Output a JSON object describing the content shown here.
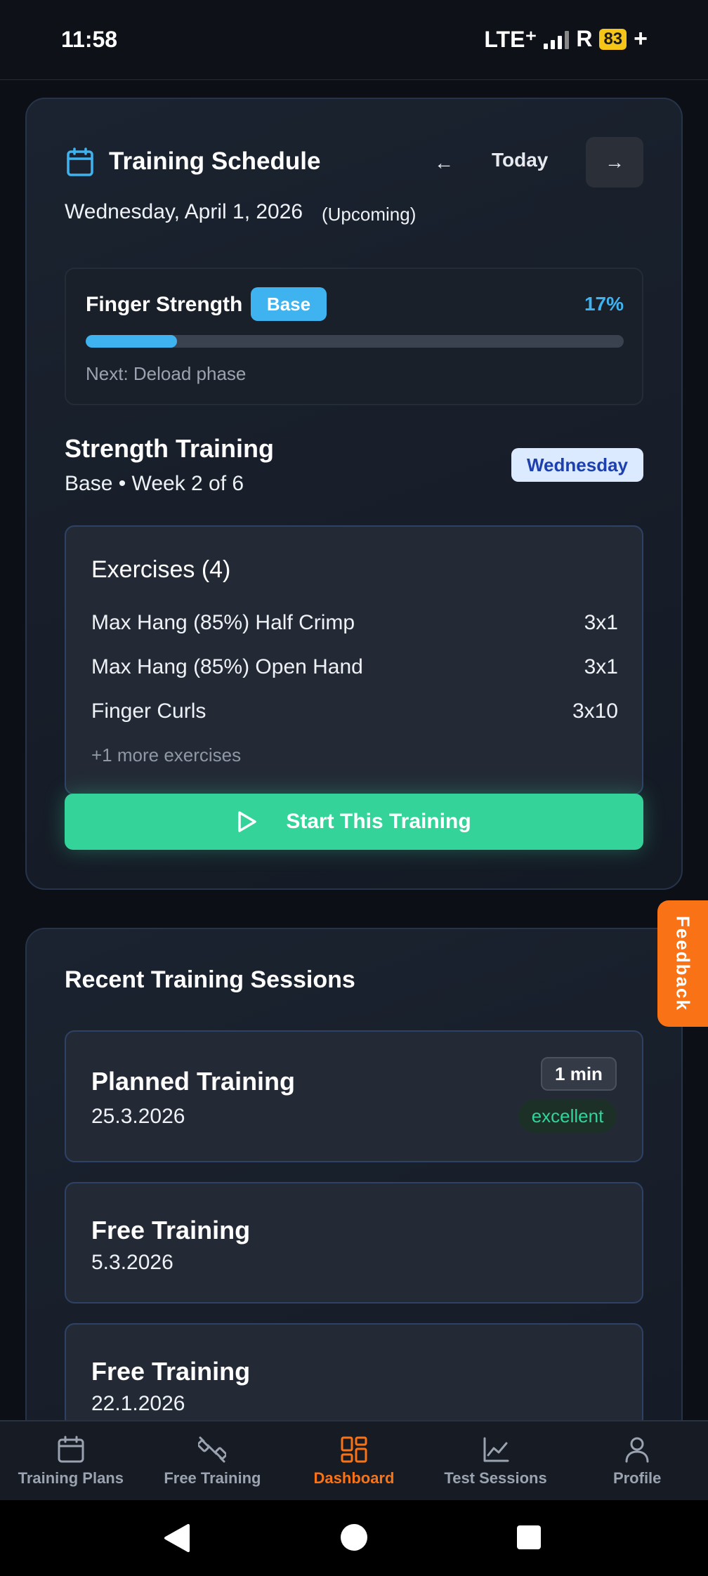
{
  "status_bar": {
    "time": "11:58",
    "network": "LTE⁺",
    "roaming": "R",
    "battery": "83",
    "charging": "+"
  },
  "schedule": {
    "title": "Training Schedule",
    "nav_prev": "←",
    "nav_today": "Today",
    "nav_next": "→",
    "date": "Wednesday, April 1, 2026",
    "status": "(Upcoming)",
    "phase": {
      "name": "Finger Strength",
      "badge": "Base",
      "percent_label": "17%",
      "progress": 0.17,
      "next": "Next: Deload phase"
    },
    "training": {
      "title": "Strength Training",
      "subtitle": "Base • Week 2 of 6",
      "day_badge": "Wednesday"
    },
    "exercises": {
      "title": "Exercises (4)",
      "items": [
        {
          "name": "Max Hang (85%) Half Crimp",
          "sets": "3x1"
        },
        {
          "name": "Max Hang (85%) Open Hand",
          "sets": "3x1"
        },
        {
          "name": "Finger Curls",
          "sets": "3x10"
        }
      ],
      "more": "+1 more exercises"
    },
    "start_button": "Start This Training"
  },
  "feedback": {
    "label": "Feedback"
  },
  "recent": {
    "title": "Recent Training Sessions",
    "sessions": [
      {
        "name": "Planned Training",
        "date": "25.3.2026",
        "duration": "1 min",
        "rating": "excellent"
      },
      {
        "name": "Free Training",
        "date": "5.3.2026"
      },
      {
        "name": "Free Training",
        "date": "22.1.2026"
      }
    ]
  },
  "bottom_nav": {
    "items": [
      {
        "label": "Training Plans",
        "icon": "calendar-icon"
      },
      {
        "label": "Free Training",
        "icon": "dumbbell-icon"
      },
      {
        "label": "Dashboard",
        "icon": "dashboard-icon",
        "active": true
      },
      {
        "label": "Test Sessions",
        "icon": "chart-icon"
      },
      {
        "label": "Profile",
        "icon": "user-icon"
      }
    ]
  },
  "colors": {
    "accent_blue": "#3fb3ef",
    "accent_green": "#34d399",
    "accent_orange": "#f97316"
  }
}
